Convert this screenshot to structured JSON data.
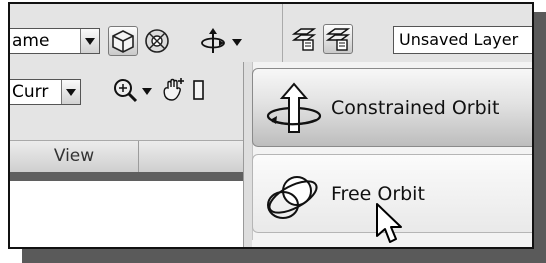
{
  "ribbon": {
    "view_style_combo": {
      "value": "ame"
    },
    "ucs_combo": {
      "value": "Curr"
    },
    "panel_label": "View"
  },
  "layer_toolbar": {
    "layer_field": {
      "value": "Unsaved Layer"
    }
  },
  "orbit_menu": {
    "items": [
      {
        "label": "Constrained Orbit",
        "icon": "constrained-orbit-icon",
        "state": "highlighted"
      },
      {
        "label": "Free Orbit",
        "icon": "free-orbit-icon",
        "state": "hovered"
      },
      {
        "label": "",
        "icon": "continuous-orbit-icon",
        "state": "partially-visible"
      }
    ]
  },
  "colors": {
    "ribbon_bg": "#e4e4e4",
    "menu_bg": "#f3f3f3",
    "shadow": "#5a5a5a"
  }
}
